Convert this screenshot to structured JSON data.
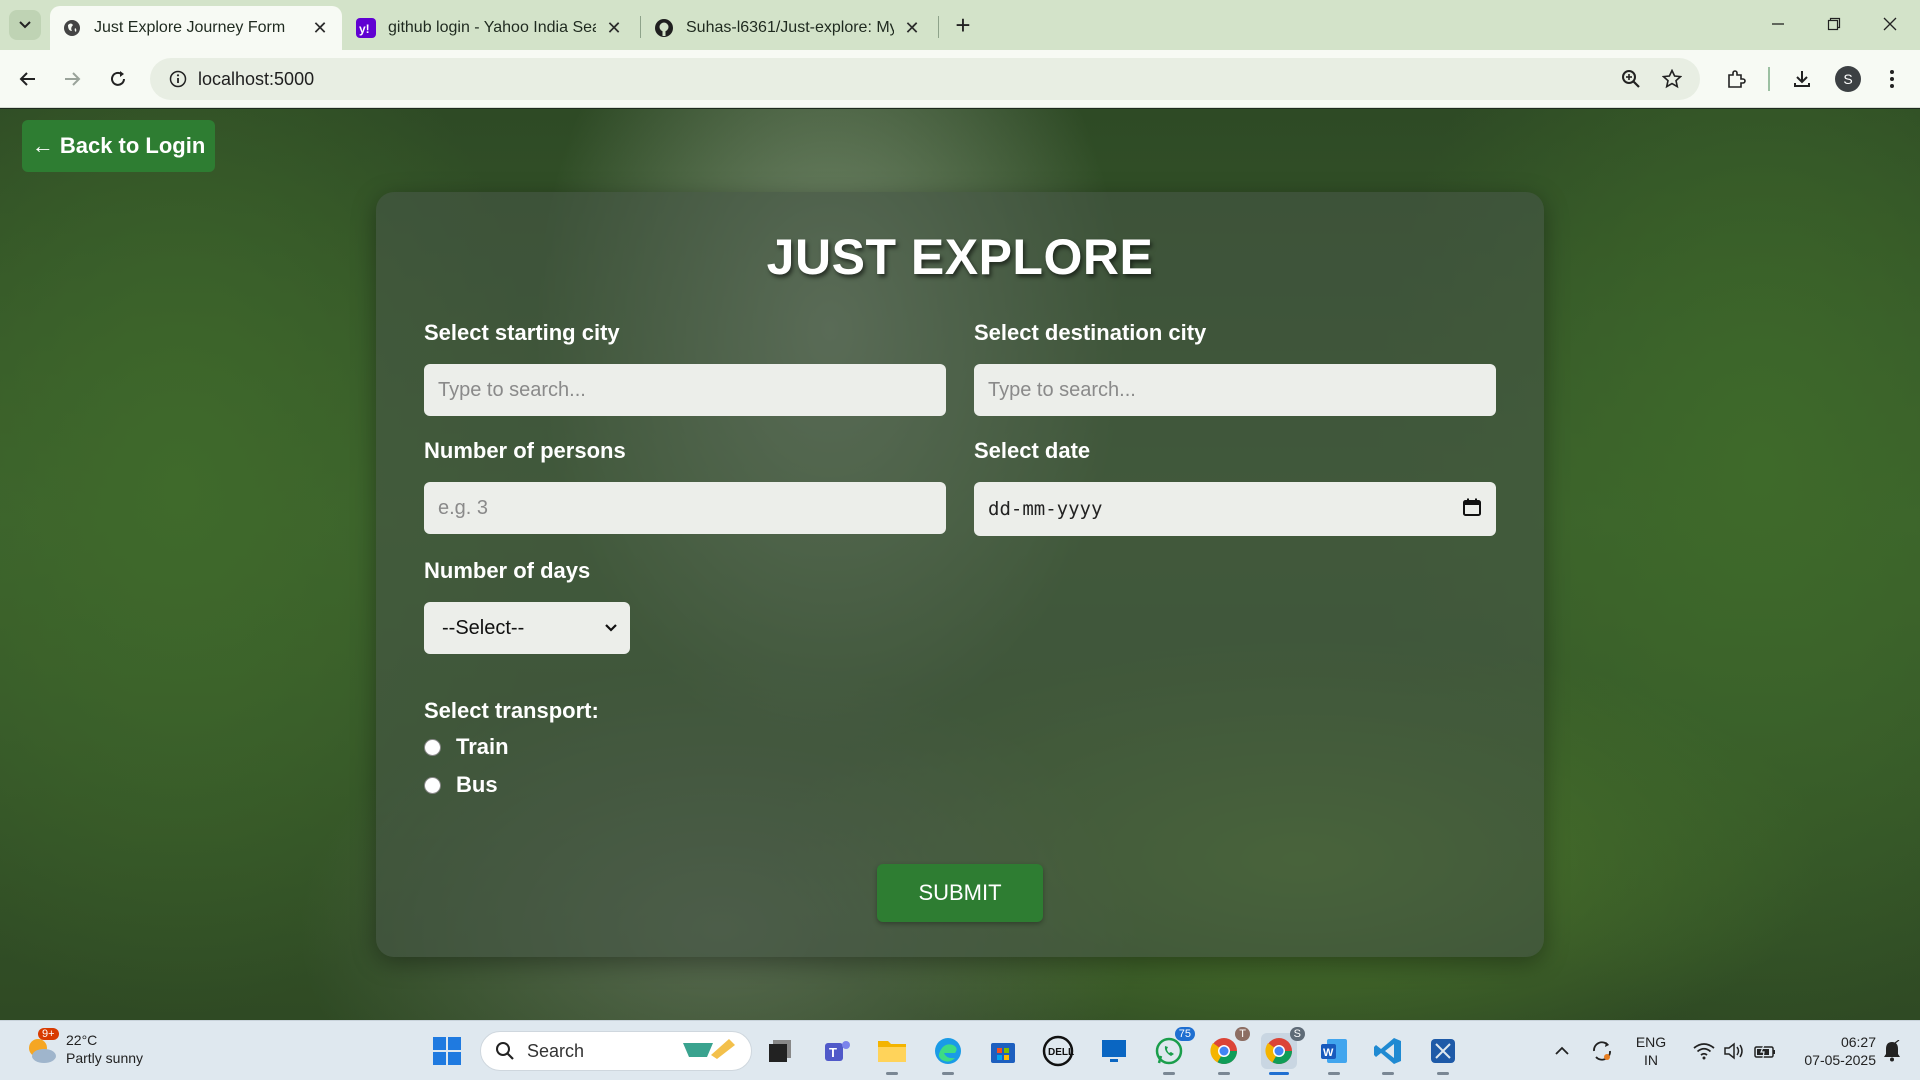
{
  "browser": {
    "tabs": [
      {
        "title": "Just Explore Journey Form",
        "active": true,
        "favicon": "globe-icon"
      },
      {
        "title": "github login - Yahoo India Sear",
        "active": false,
        "favicon": "yahoo-icon"
      },
      {
        "title": "Suhas-l6361/Just-explore: My n",
        "active": false,
        "favicon": "github-icon"
      }
    ],
    "url": "localhost:5000"
  },
  "page": {
    "back_button": "← Back to Login",
    "title": "JUST EXPLORE",
    "start_city": {
      "label": "Select starting city",
      "placeholder": "Type to search..."
    },
    "dest_city": {
      "label": "Select destination city",
      "placeholder": "Type to search..."
    },
    "persons": {
      "label": "Number of persons",
      "placeholder": "e.g. 3"
    },
    "date": {
      "label": "Select date",
      "value": "dd-mm-yyyy"
    },
    "days": {
      "label": "Number of days",
      "selected": "--Select--"
    },
    "transport": {
      "label": "Select transport:",
      "options": [
        "Train",
        "Bus"
      ]
    },
    "submit": "SUBMIT"
  },
  "taskbar": {
    "weather": {
      "temp": "22°C",
      "desc": "Partly sunny",
      "badge": "9+"
    },
    "search": "Search",
    "whatsapp_badge": "75",
    "chrome_badge_1": "T",
    "chrome_badge_2": "S",
    "lang_1": "ENG",
    "lang_2": "IN",
    "time": "06:27",
    "date": "07-05-2025"
  },
  "colors": {
    "accent_green": "#2e7d32",
    "tabbar": "#d3e3c9"
  }
}
